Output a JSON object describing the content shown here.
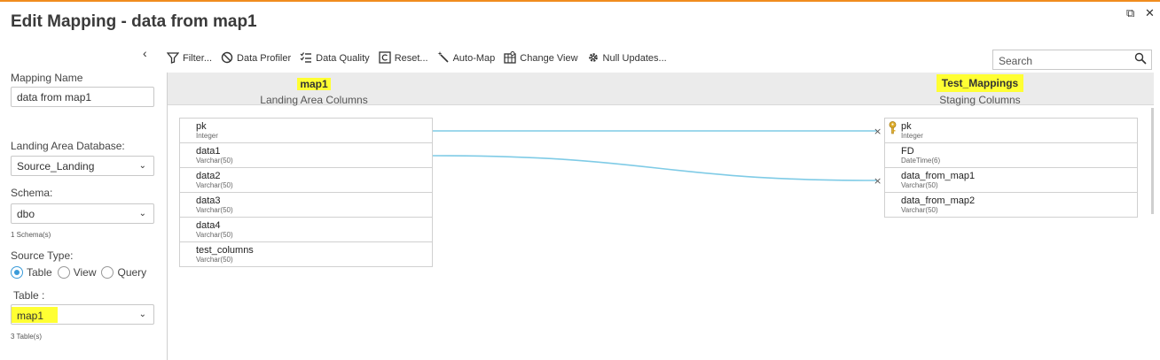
{
  "window": {
    "title": "Edit Mapping - data from map1",
    "restore_icon": "⧉",
    "close_icon": "✕"
  },
  "sidebar": {
    "collapse_icon": "‹",
    "mapping_name_label": "Mapping Name",
    "mapping_name_value": "data from map1",
    "landing_db_label": "Landing Area Database:",
    "landing_db_value": "Source_Landing",
    "schema_label": "Schema:",
    "schema_value": "dbo",
    "schema_count": "1 Schema(s)",
    "source_type_label": "Source Type:",
    "source_types": [
      "Table",
      "View",
      "Query"
    ],
    "source_type_selected": "Table",
    "table_label": "Table :",
    "table_value": "map1",
    "table_count": "3 Table(s)"
  },
  "toolbar": {
    "items": [
      {
        "label": "Filter...",
        "icon": "filter-icon"
      },
      {
        "label": "Data Profiler",
        "icon": "no-entry-icon"
      },
      {
        "label": "Data Quality",
        "icon": "checklist-icon"
      },
      {
        "label": "Reset...",
        "icon": "reset-icon"
      },
      {
        "label": "Auto-Map",
        "icon": "wand-icon"
      },
      {
        "label": "Change View",
        "icon": "grid-icon"
      },
      {
        "label": "Null Updates...",
        "icon": "gear-icon"
      }
    ]
  },
  "search": {
    "placeholder": "Search"
  },
  "left_table": {
    "name": "map1",
    "subtitle": "Landing Area Columns",
    "columns": [
      {
        "name": "pk",
        "type": "Integer"
      },
      {
        "name": "data1",
        "type": "Varchar(50)"
      },
      {
        "name": "data2",
        "type": "Varchar(50)"
      },
      {
        "name": "data3",
        "type": "Varchar(50)"
      },
      {
        "name": "data4",
        "type": "Varchar(50)"
      },
      {
        "name": "test_columns",
        "type": "Varchar(50)"
      }
    ]
  },
  "right_table": {
    "name": "Test_Mappings",
    "subtitle": "Staging Columns",
    "columns": [
      {
        "name": "pk",
        "type": "Integer",
        "key": true
      },
      {
        "name": "FD",
        "type": "DateTime(6)",
        "key": false
      },
      {
        "name": "data_from_map1",
        "type": "Varchar(50)",
        "key": false
      },
      {
        "name": "data_from_map2",
        "type": "Varchar(50)",
        "key": false
      }
    ]
  },
  "mappings": [
    {
      "from": "pk",
      "to": "pk"
    },
    {
      "from": "data1",
      "to": "data_from_map1"
    }
  ],
  "colors": {
    "highlight": "#ffff33",
    "link_line": "#7fcbe6",
    "accent_top": "#f08c1e",
    "radio_on": "#3a9bd9"
  }
}
